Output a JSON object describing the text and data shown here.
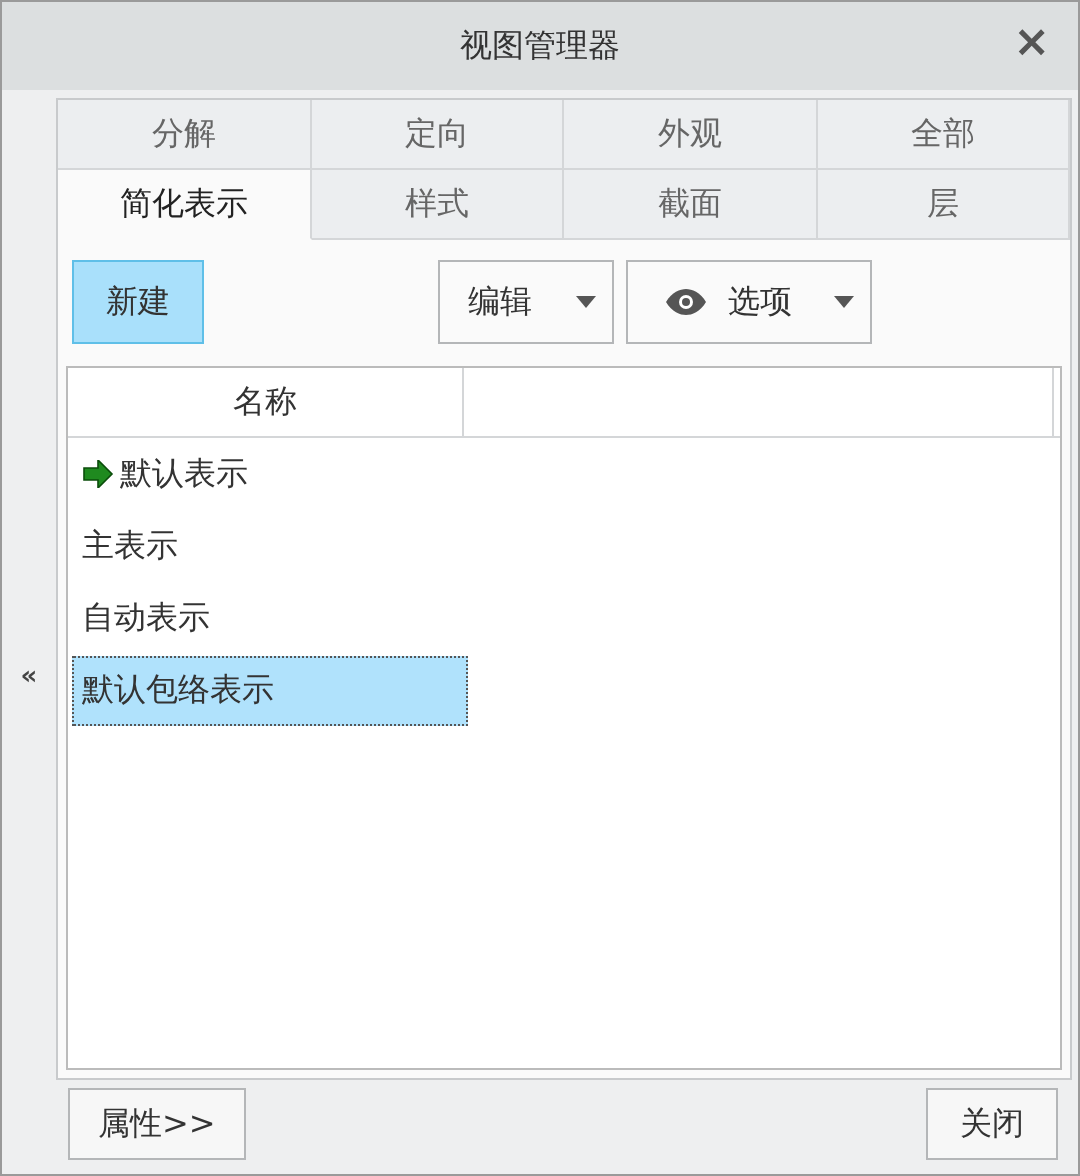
{
  "window": {
    "title": "视图管理器",
    "close": "×"
  },
  "collapse": "«",
  "tab_rows": [
    [
      {
        "label": "分解",
        "selected": false
      },
      {
        "label": "定向",
        "selected": false
      },
      {
        "label": "外观",
        "selected": false
      },
      {
        "label": "全部",
        "selected": false
      }
    ],
    [
      {
        "label": "简化表示",
        "selected": true
      },
      {
        "label": "样式",
        "selected": false
      },
      {
        "label": "截面",
        "selected": false
      },
      {
        "label": "层",
        "selected": false
      }
    ]
  ],
  "toolbar": {
    "new": "新建",
    "edit": "编辑",
    "options": "选项"
  },
  "table": {
    "columns": [
      "名称"
    ],
    "rows": [
      {
        "name": "默认表示",
        "current": true,
        "selected": false
      },
      {
        "name": "主表示",
        "current": false,
        "selected": false
      },
      {
        "name": "自动表示",
        "current": false,
        "selected": false
      },
      {
        "name": "默认包络表示",
        "current": false,
        "selected": true
      }
    ]
  },
  "buttons": {
    "properties": "属性>>",
    "close": "关闭"
  }
}
